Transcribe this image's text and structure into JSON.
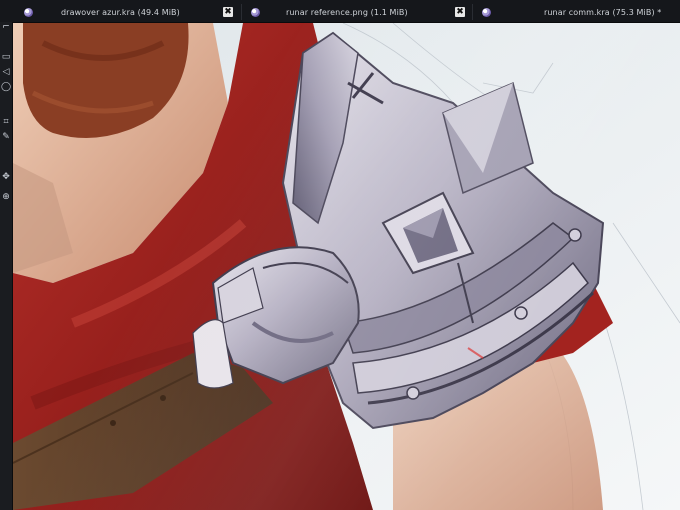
{
  "tabs": [
    {
      "title": "drawover azur.kra (49.4 MiB)",
      "active": false
    },
    {
      "title": "runar reference.png (1.1 MiB)",
      "active": true
    },
    {
      "title": "runar comm.kra (75.3 MiB) *",
      "active": false
    }
  ],
  "tab_close_symbol": "✖",
  "tab_icon": "krita-logo-icon",
  "toolbox": {
    "tools": [
      {
        "icon": "transform-tool-icon",
        "glyph": "⌐"
      },
      {
        "icon": "rectangle-select-icon",
        "glyph": "▭"
      },
      {
        "icon": "polygon-select-icon",
        "glyph": "◁"
      },
      {
        "icon": "lasso-icon",
        "glyph": "◯"
      },
      {
        "icon": "crop-tool-icon",
        "glyph": "⌗"
      },
      {
        "icon": "brush-tool-icon",
        "glyph": "✎"
      },
      {
        "icon": "move-tool-icon",
        "glyph": "✥"
      },
      {
        "icon": "zoom-tool-icon",
        "glyph": "⊕"
      }
    ]
  },
  "colors": {
    "background_chrome": "#15171b",
    "cape_red": "#a3231f",
    "skin": "#d9a68a",
    "armor_steel": "#b9b4c4",
    "strap_brown": "#5a3a22"
  }
}
